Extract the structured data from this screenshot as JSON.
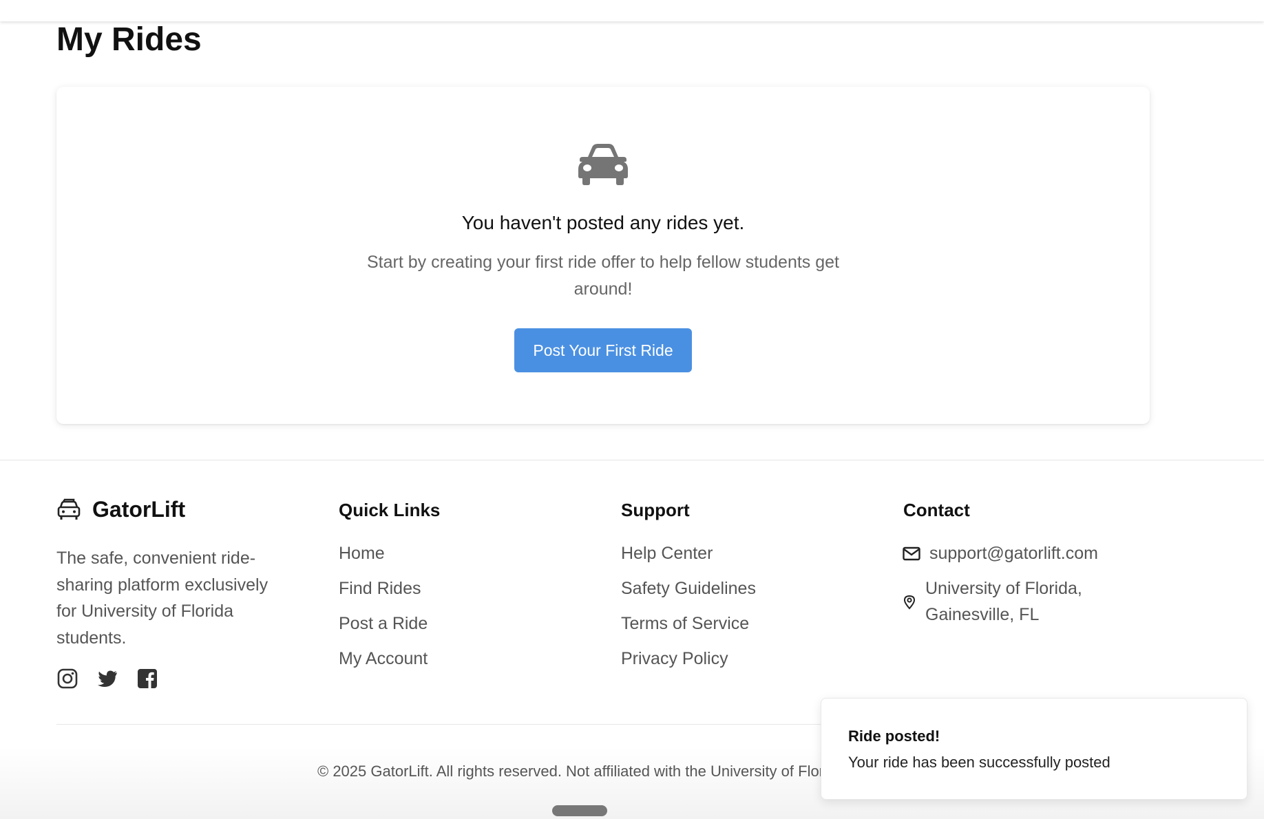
{
  "page": {
    "title": "My Rides"
  },
  "empty_state": {
    "icon": "car-icon",
    "heading": "You haven't posted any rides yet.",
    "subtext": "Start by creating your first ride offer to help fellow students get around!",
    "cta_label": "Post Your First Ride"
  },
  "footer": {
    "brand": {
      "icon": "car-front-icon",
      "name": "GatorLift",
      "description": "The safe, convenient ride-sharing platform exclusively for University of Florida students."
    },
    "social": [
      "instagram-icon",
      "twitter-icon",
      "facebook-icon"
    ],
    "quick_links": {
      "title": "Quick Links",
      "items": [
        "Home",
        "Find Rides",
        "Post a Ride",
        "My Account"
      ]
    },
    "support": {
      "title": "Support",
      "items": [
        "Help Center",
        "Safety Guidelines",
        "Terms of Service",
        "Privacy Policy"
      ]
    },
    "contact": {
      "title": "Contact",
      "email": "support@gatorlift.com",
      "address_line1": "University of Florida,",
      "address_line2": "Gainesville, FL"
    },
    "copyright": "© 2025 GatorLift. All rights reserved. Not affiliated with the University of Florida."
  },
  "toast": {
    "title": "Ride posted!",
    "message": "Your ride has been successfully posted"
  },
  "colors": {
    "primary": "#4a90e2",
    "icon_gray": "#757575",
    "muted_text": "#555555"
  }
}
